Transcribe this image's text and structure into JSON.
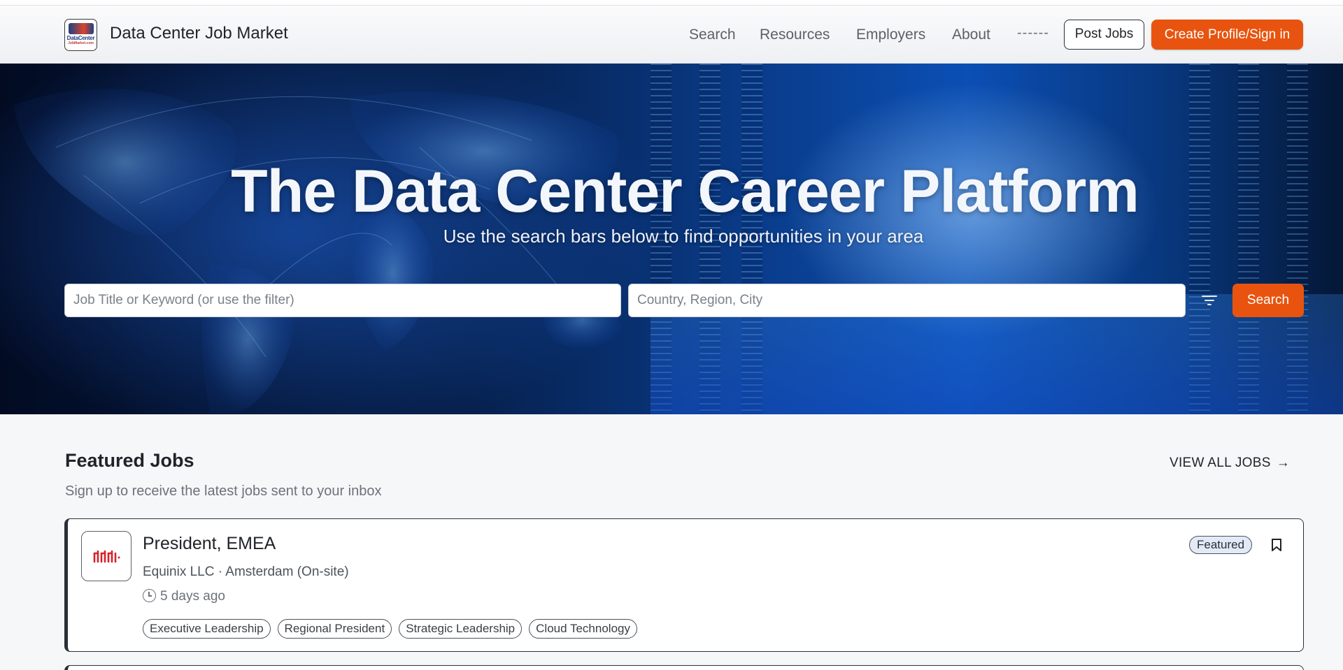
{
  "header": {
    "brand": "Data Center Job Market",
    "logo_text": "DataCenter",
    "logo_subtext": "JobMarket.com",
    "nav": [
      "Search",
      "Resources",
      "Employers",
      "About"
    ],
    "nav_more": "------",
    "post_jobs": "Post Jobs",
    "create_profile": "Create Profile/Sign in"
  },
  "hero": {
    "title": "The Data Center Career Platform",
    "subtitle": "Use the search bars below to find opportunities in your area",
    "keyword_placeholder": "Job Title or Keyword (or use the filter)",
    "location_placeholder": "Country, Region, City",
    "search_button": "Search"
  },
  "featured": {
    "title": "Featured Jobs",
    "subtitle": "Sign up to receive the latest jobs sent to your inbox",
    "view_all": "VIEW ALL JOBS",
    "jobs": [
      {
        "title": "President, EMEA",
        "company": "Equinix LLC",
        "separator": "·",
        "location": "Amsterdam (On-site)",
        "posted": "5 days ago",
        "badge": "Featured",
        "tags": [
          "Executive Leadership",
          "Regional President",
          "Strategic Leadership",
          "Cloud Technology"
        ]
      }
    ]
  },
  "colors": {
    "accent": "#e8540f",
    "text": "#1f2328",
    "muted": "#6c727a",
    "company_logo": "#d6232a"
  },
  "icons": [
    "filter-icon",
    "clock-icon",
    "bookmark-icon",
    "arrow-right-icon"
  ]
}
